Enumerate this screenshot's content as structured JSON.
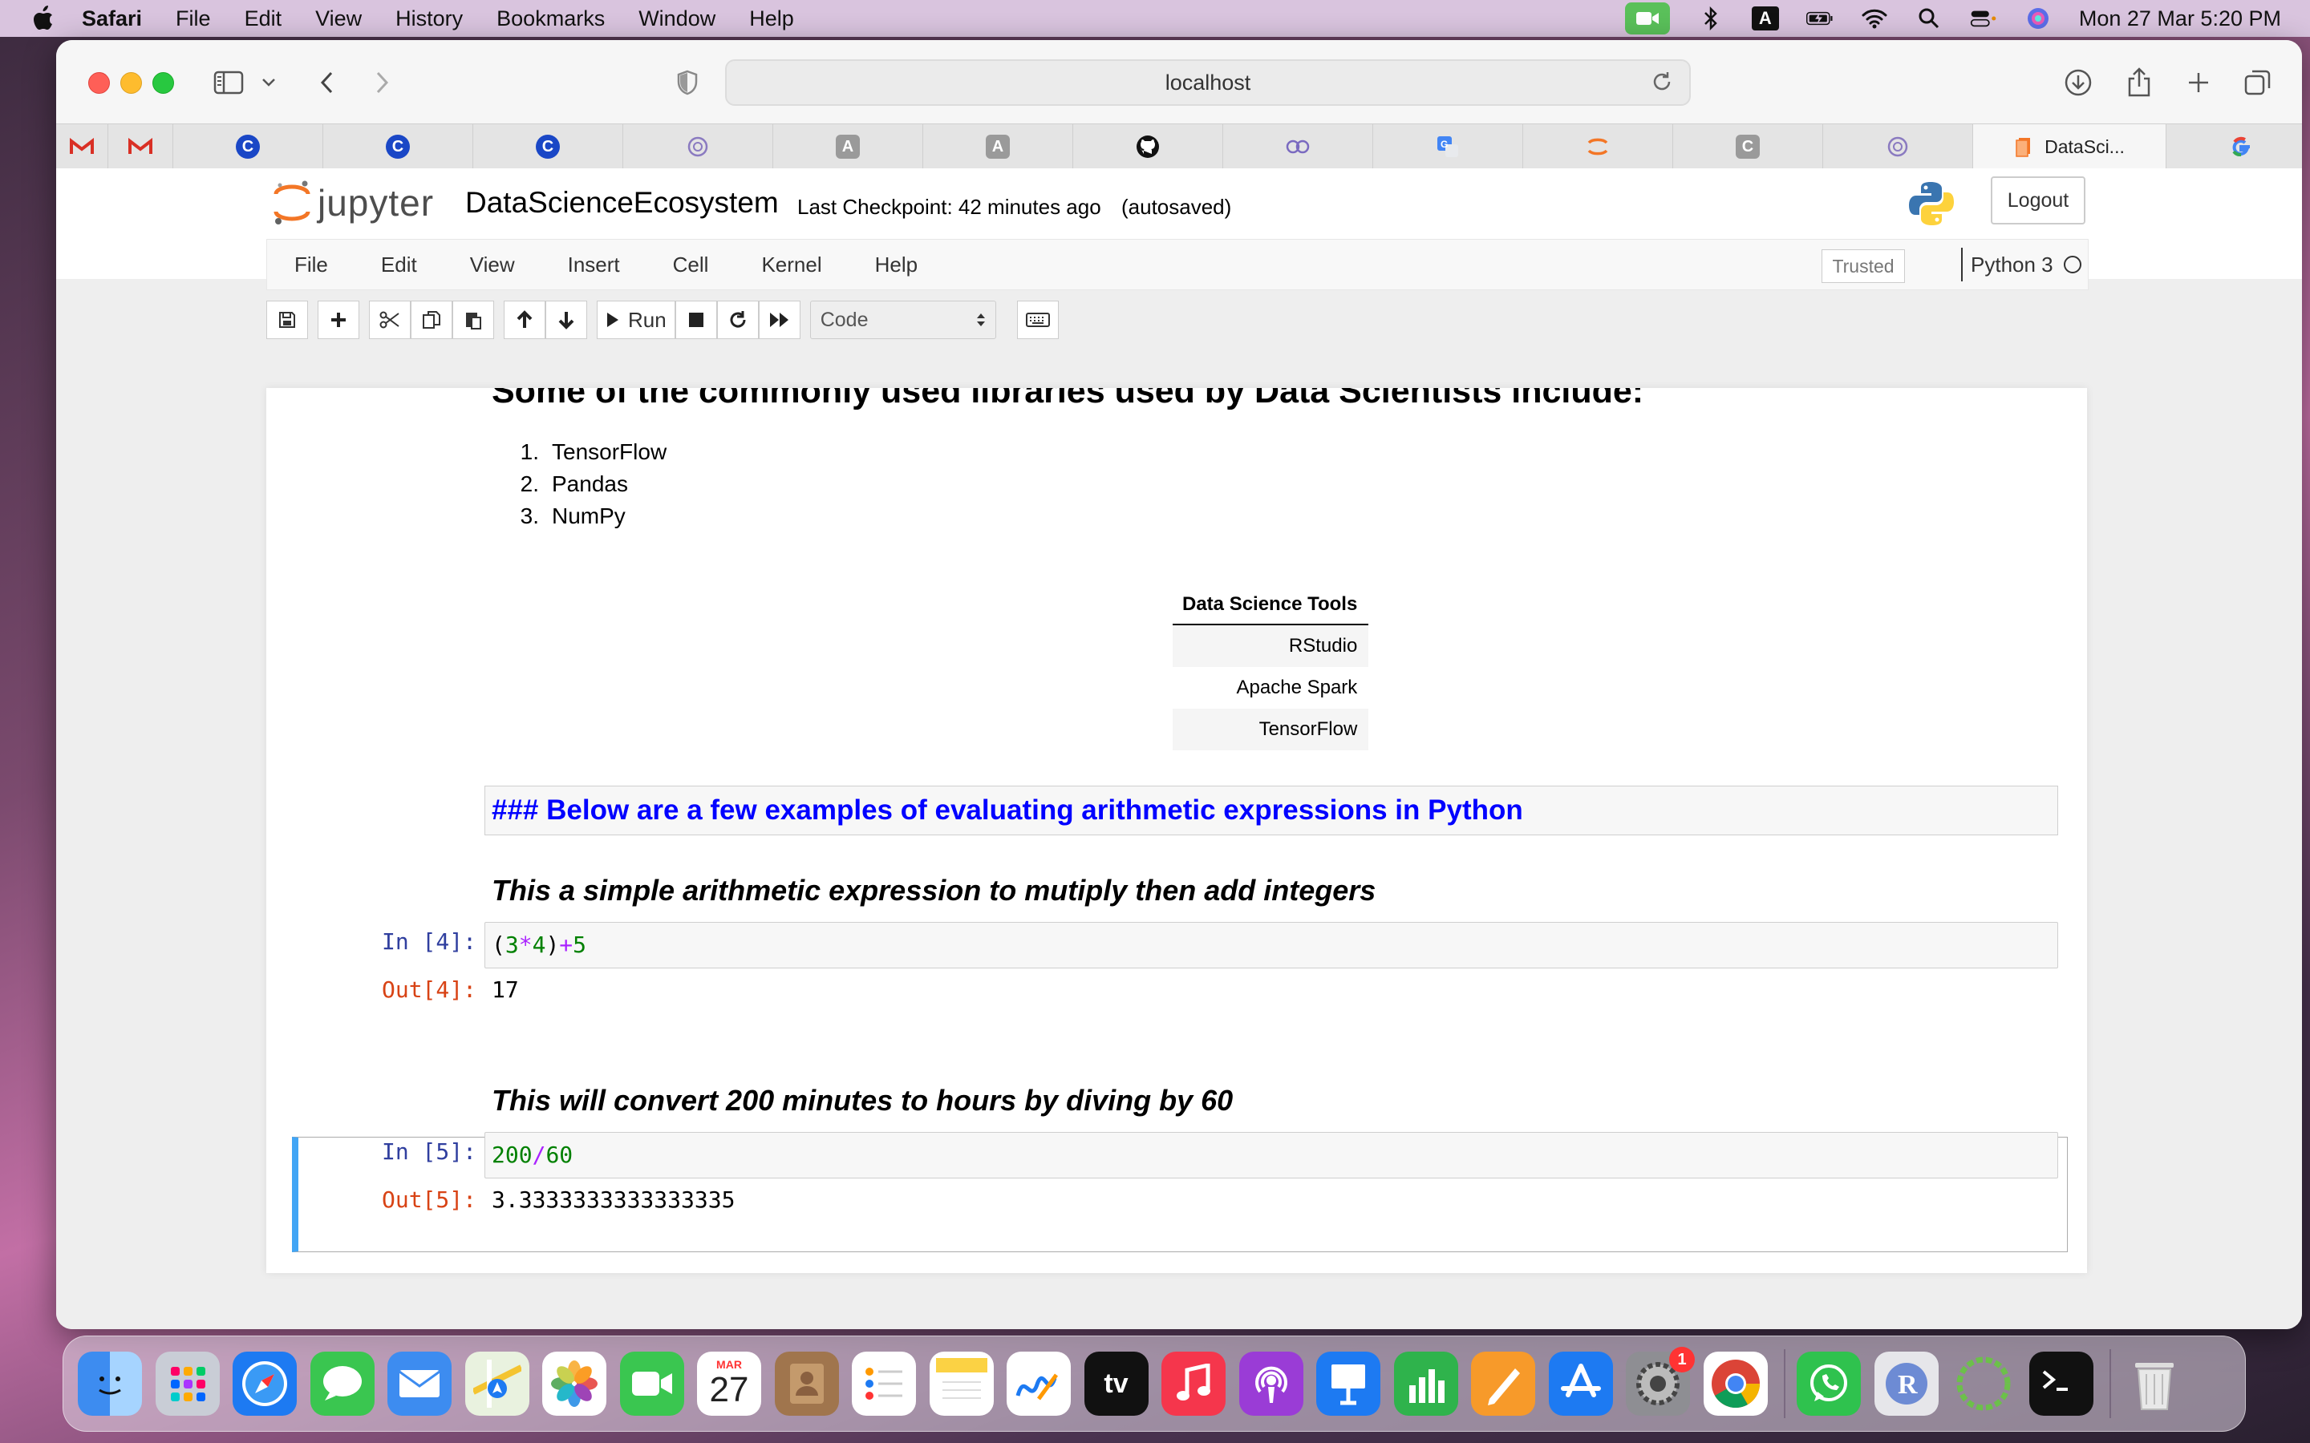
{
  "menubar": {
    "app": "Safari",
    "items": [
      "File",
      "Edit",
      "View",
      "History",
      "Bookmarks",
      "Window",
      "Help"
    ],
    "clock": "Mon 27 Mar  5:20 PM",
    "tray_letter": "A"
  },
  "browser": {
    "url": "localhost",
    "active_tab_title": "DataSci...",
    "tab_icons": [
      "gmail-icon",
      "gmail-icon",
      "c-icon",
      "c-icon",
      "c-icon",
      "openai-icon",
      "a-icon",
      "a-icon",
      "github-icon",
      "wave-icon",
      "translate-icon",
      "jupyter-icon",
      "c-icon",
      "openai-icon",
      "jupyter-icon",
      "google-icon"
    ]
  },
  "jupyter": {
    "logo_text": "jupyter",
    "notebook_title": "DataScienceEcosystem",
    "checkpoint": "Last Checkpoint: 42 minutes ago",
    "autosave": "(autosaved)",
    "logout": "Logout",
    "menu": [
      "File",
      "Edit",
      "View",
      "Insert",
      "Cell",
      "Kernel",
      "Help"
    ],
    "trusted": "Trusted",
    "kernel": "Python 3",
    "run_label": "Run",
    "cell_type": "Code"
  },
  "notebook": {
    "libraries_heading": "Some of the commonly used libraries used by Data Scientists include:",
    "libraries": [
      {
        "n": "1.",
        "name": "TensorFlow"
      },
      {
        "n": "2.",
        "name": "Pandas"
      },
      {
        "n": "3.",
        "name": "NumPy"
      }
    ],
    "tools_header": "Data Science Tools",
    "tools": [
      "RStudio",
      "Apache Spark",
      "TensorFlow"
    ],
    "raw_markdown": "###  Below are a few examples of evaluating arithmetic expressions in Python",
    "cell1_heading": "This a simple arithmetic expression to mutiply then add integers",
    "cell1_in_prompt": "In [4]:",
    "cell1_out_prompt": "Out[4]:",
    "cell1_code": {
      "p1": "(",
      "a": "3",
      "op1": "*",
      "b": "4",
      "p2": ")",
      "op2": "+",
      "c": "5"
    },
    "cell1_output": "17",
    "cell2_heading": "This will convert 200 minutes to hours by diving by 60",
    "cell2_in_prompt": "In [5]:",
    "cell2_out_prompt": "Out[5]:",
    "cell2_code": {
      "a": "200",
      "op": "/",
      "b": "60"
    },
    "cell2_output": "3.3333333333333335"
  },
  "dock": {
    "calendar_month": "MAR",
    "calendar_day": "27",
    "settings_badge": "1",
    "tv_label": "tv"
  }
}
